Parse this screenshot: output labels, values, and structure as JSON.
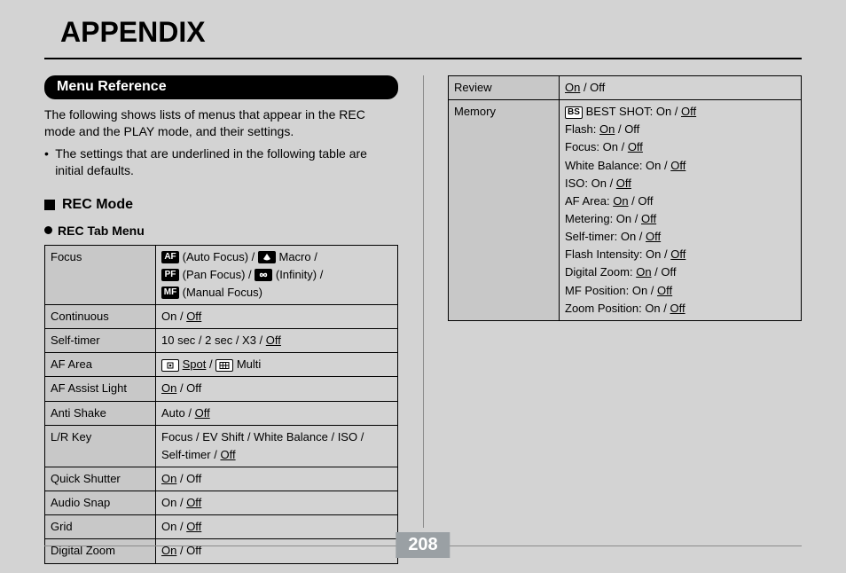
{
  "title": "APPENDIX",
  "section": "Menu Reference",
  "intro": "The following shows lists of menus that appear in the REC mode and the PLAY mode, and their settings.",
  "note": "The settings that are underlined in the following table are initial defaults.",
  "h2": "REC Mode",
  "h3": "REC Tab Menu",
  "left_rows": [
    {
      "label": "Focus",
      "type": "focus"
    },
    {
      "label": "Continuous",
      "type": "onoff",
      "default": "Off"
    },
    {
      "label": "Self-timer",
      "type": "selftimer"
    },
    {
      "label": "AF Area",
      "type": "afarea"
    },
    {
      "label": "AF Assist Light",
      "type": "onoff",
      "default": "On"
    },
    {
      "label": "Anti Shake",
      "type": "autooff"
    },
    {
      "label": "L/R Key",
      "type": "lrkey"
    },
    {
      "label": "Quick Shutter",
      "type": "onoff",
      "default": "On"
    },
    {
      "label": "Audio Snap",
      "type": "onoff",
      "default": "Off"
    },
    {
      "label": "Grid",
      "type": "onoff",
      "default": "Off"
    },
    {
      "label": "Digital Zoom",
      "type": "onoff",
      "default": "On"
    }
  ],
  "focus": {
    "af": "(Auto Focus)",
    "macro": "Macro",
    "pf": "(Pan Focus)",
    "inf": "(Infinity)",
    "mf": "(Manual Focus)"
  },
  "selftimer": {
    "opts": "10 sec / 2 sec / X3 /",
    "default": "Off"
  },
  "afarea": {
    "spot": "Spot",
    "multi": "Multi"
  },
  "autooff": {
    "auto": "Auto",
    "off": "Off"
  },
  "lrkey": {
    "line1": "Focus / EV Shift / White Balance / ISO /",
    "line2_pre": "Self-timer /",
    "default": "Off"
  },
  "right_rows": [
    {
      "label": "Review",
      "type": "onoff",
      "default": "On"
    },
    {
      "label": "Memory",
      "type": "memory"
    }
  ],
  "memory": [
    {
      "icon": "BS",
      "name": "BEST SHOT",
      "default": "Off"
    },
    {
      "name": "Flash",
      "default": "On"
    },
    {
      "name": "Focus",
      "default": "Off"
    },
    {
      "name": "White Balance",
      "default": "Off"
    },
    {
      "name": "ISO",
      "default": "Off"
    },
    {
      "name": "AF Area",
      "default": "On"
    },
    {
      "name": "Metering",
      "default": "Off"
    },
    {
      "name": "Self-timer",
      "default": "Off"
    },
    {
      "name": "Flash Intensity",
      "default": "Off"
    },
    {
      "name": "Digital Zoom",
      "default": "On"
    },
    {
      "name": "MF Position",
      "default": "Off"
    },
    {
      "name": "Zoom Position",
      "default": "Off"
    }
  ],
  "labels": {
    "on": "On",
    "off": "Off",
    "sep": " / "
  },
  "page_number": "208"
}
